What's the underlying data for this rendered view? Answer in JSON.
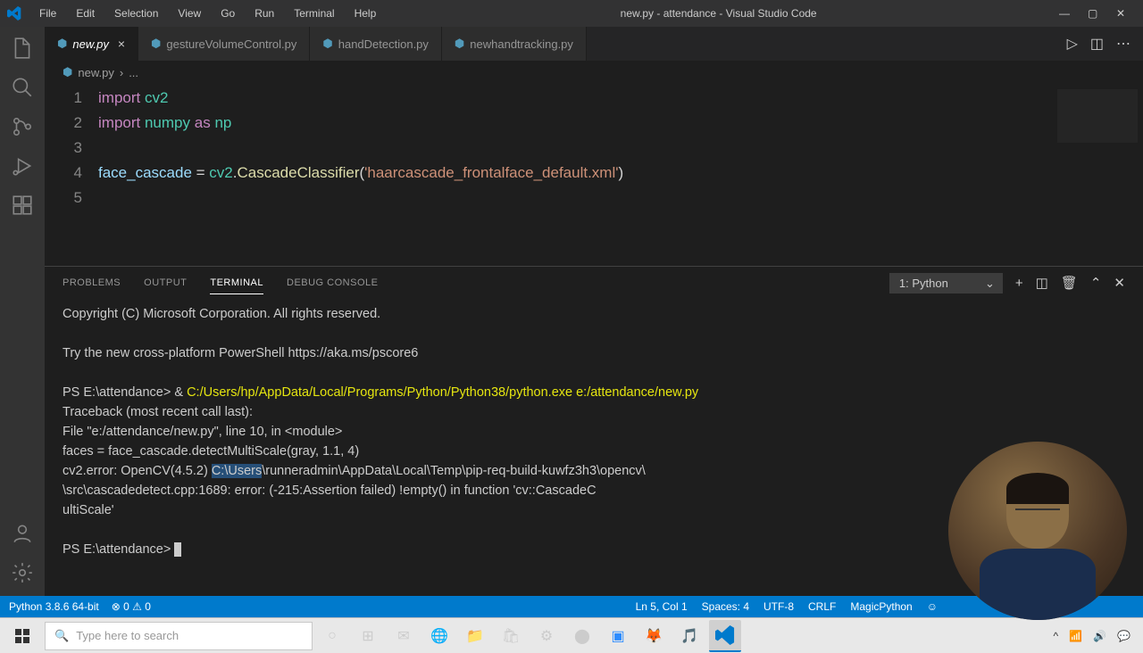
{
  "window": {
    "title": "new.py - attendance - Visual Studio Code"
  },
  "menu": [
    "File",
    "Edit",
    "Selection",
    "View",
    "Go",
    "Run",
    "Terminal",
    "Help"
  ],
  "tabs": [
    {
      "name": "new.py",
      "active": true
    },
    {
      "name": "gestureVolumeControl.py",
      "active": false
    },
    {
      "name": "handDetection.py",
      "active": false
    },
    {
      "name": "newhandtracking.py",
      "active": false
    }
  ],
  "breadcrumb": {
    "file": "new.py",
    "sep": "›",
    "more": "..."
  },
  "code": {
    "lines": [
      "1",
      "2",
      "3",
      "4",
      "5"
    ],
    "l1": {
      "kw1": "import",
      "mod": "cv2"
    },
    "l2": {
      "kw1": "import",
      "mod": "numpy",
      "kw2": "as",
      "alias": "np"
    },
    "l4": {
      "var": "face_cascade",
      "op": " = ",
      "mod": "cv2",
      "dot": ".",
      "func": "CascadeClassifier",
      "open": "(",
      "str": "'haarcascade_frontalface_default.xml'",
      "close": ")"
    }
  },
  "panel": {
    "tabs": [
      "PROBLEMS",
      "OUTPUT",
      "TERMINAL",
      "DEBUG CONSOLE"
    ],
    "active": 2,
    "selector": "1: Python"
  },
  "terminal": {
    "l1": "Copyright (C) Microsoft Corporation. All rights reserved.",
    "l2": "Try the new cross-platform PowerShell https://aka.ms/pscore6",
    "l3a": "PS E:\\attendance> & ",
    "l3b": "C:/Users/hp/AppData/Local/Programs/Python/Python38/python.exe e:/attendance/new.py",
    "l4": "Traceback (most recent call last):",
    "l5": "  File \"e:/attendance/new.py\", line 10, in <module>",
    "l6": "    faces = face_cascade.detectMultiScale(gray, 1.1, 4)",
    "l7a": "cv2.error: OpenCV(4.5.2) ",
    "l7b": "C:\\Users",
    "l7c": "\\runneradmin\\AppData\\Local\\Temp\\pip-req-build-kuwfz3h3\\opencv\\",
    "l8": "\\src\\cascadedetect.cpp:1689: error: (-215:Assertion failed) !empty() in function 'cv::CascadeC",
    "l9": "ultiScale'",
    "l10": "PS E:\\attendance> "
  },
  "status": {
    "python": "Python 3.8.6 64-bit",
    "errors": "⊗ 0 ⚠ 0",
    "pos": "Ln 5, Col 1",
    "spaces": "Spaces: 4",
    "enc": "UTF-8",
    "eol": "CRLF",
    "lang": "MagicPython"
  },
  "taskbar": {
    "search": "Type here to search"
  }
}
